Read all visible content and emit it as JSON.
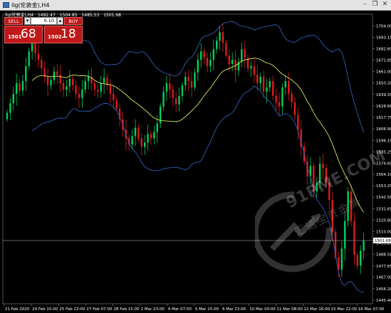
{
  "window": {
    "title": "llg(伦敦金),H4"
  },
  "info_bar": {
    "symbol": "llg(伦敦金),H4",
    "open": "1492.47",
    "high": "1504.85",
    "low": "1485.53",
    "close": "1501.68"
  },
  "trade_panel": {
    "sell_label": "SELL",
    "buy_label": "BUY",
    "lot_value": "0.10",
    "sell_price_prefix": "1501",
    "sell_price_big": "68",
    "buy_price_prefix": "1502",
    "buy_price_big": "18",
    "colors": {
      "button_red": "#c01818"
    }
  },
  "watermark": {
    "text": "91PME.COM",
    "sub": "汇通宝贵金属"
  },
  "chart_data": {
    "type": "candlestick",
    "symbol": "llg(伦敦金)",
    "timeframe": "H4",
    "y_ticks": [
      "1704.00",
      "1693.15",
      "1682.60",
      "1671.85",
      "1661.00",
      "1650.20",
      "1639.35",
      "1628.60",
      "1617.75",
      "1606.90",
      "1596.10",
      "1585.25",
      "1574.60",
      "1564.10",
      "1553.25",
      "1542.50",
      "1531.65",
      "1520.80",
      "1510.00",
      "1499.20",
      "1488.50",
      "1477.65",
      "1467.00",
      "1456.20",
      "1445.40"
    ],
    "ylim": [
      1442,
      1715
    ],
    "current_price": "1501.68",
    "x_ticks": [
      "21 Feb 2020",
      "24 Feb 15:00",
      "25 Feb 23:00",
      "27 Feb 07:00",
      "28 Feb 15:00",
      "2 Mar 23:00",
      "4 Mar 07:00",
      "5 Mar 15:00",
      "6 Mar 23:00",
      "10 Mar 00:00",
      "11 Mar 08:00",
      "12 Mar 16:00",
      "15 Mar 22:00",
      "16 Mar 07:00"
    ],
    "closes": [
      1622,
      1631,
      1640,
      1650,
      1643,
      1652,
      1666,
      1680,
      1688,
      1678,
      1672,
      1664,
      1656,
      1648,
      1653,
      1661,
      1658,
      1650,
      1644,
      1647,
      1654,
      1648,
      1640,
      1636,
      1644,
      1652,
      1656,
      1650,
      1644,
      1642,
      1650,
      1655,
      1648,
      1640,
      1634,
      1626,
      1616,
      1606,
      1598,
      1592,
      1600,
      1608,
      1598,
      1590,
      1594,
      1602,
      1598,
      1604,
      1612,
      1628,
      1642,
      1650,
      1644,
      1636,
      1630,
      1638,
      1648,
      1656,
      1652,
      1646,
      1660,
      1672,
      1680,
      1674,
      1666,
      1672,
      1682,
      1690,
      1698,
      1688,
      1676,
      1668,
      1672,
      1662,
      1670,
      1682,
      1674,
      1664,
      1666,
      1658,
      1650,
      1656,
      1642,
      1646,
      1652,
      1638,
      1632,
      1628,
      1646,
      1652,
      1640,
      1632,
      1620,
      1606,
      1590,
      1576,
      1562,
      1572,
      1548,
      1556,
      1574,
      1570,
      1556,
      1540,
      1510,
      1486,
      1474,
      1494,
      1520,
      1548,
      1520,
      1488,
      1478,
      1492,
      1501.68
    ],
    "series": [
      {
        "name": "BB middle",
        "color": "#d8e85a"
      },
      {
        "name": "BB upper",
        "color": "#2f5fb5"
      },
      {
        "name": "BB lower",
        "color": "#2f5fb5"
      }
    ],
    "colors": {
      "bull": "#00d15a",
      "bear": "#e01b1b"
    }
  }
}
